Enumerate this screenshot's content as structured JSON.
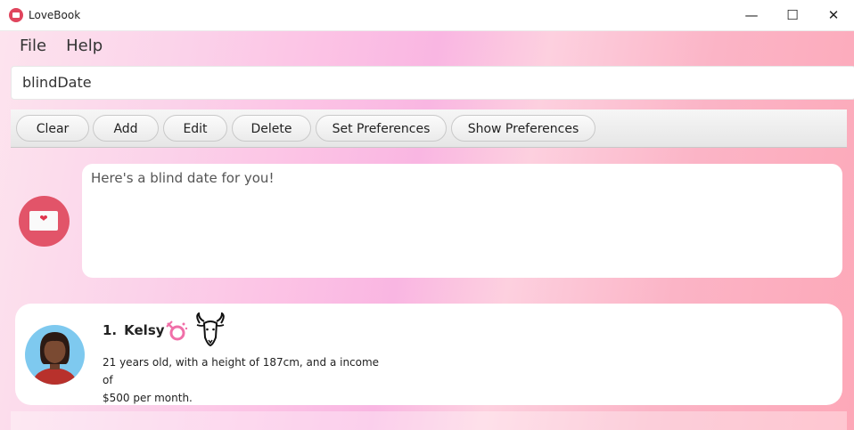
{
  "window": {
    "title": "LoveBook",
    "minimize": "—",
    "maximize": "☐",
    "close": "✕"
  },
  "menu": {
    "items": [
      "File",
      "Help"
    ]
  },
  "command_input": {
    "value": "blindDate"
  },
  "toolbar": {
    "buttons": [
      "Clear",
      "Add",
      "Edit",
      "Delete",
      "Set Preferences",
      "Show Preferences"
    ]
  },
  "result": {
    "text": "Here's a blind date for you!"
  },
  "person": {
    "index": "1.",
    "name": "Kelsy",
    "description_line1": "21 years old, with a height of 187cm, and a income of",
    "description_line2": "$500 per month.",
    "gender_icon": "female-gender-icon",
    "zodiac_icon": "capricorn-goat-icon"
  },
  "colors": {
    "accent": "#e25469",
    "avatar_bg": "#7ec9ef",
    "gender_pink": "#f06fa8"
  }
}
